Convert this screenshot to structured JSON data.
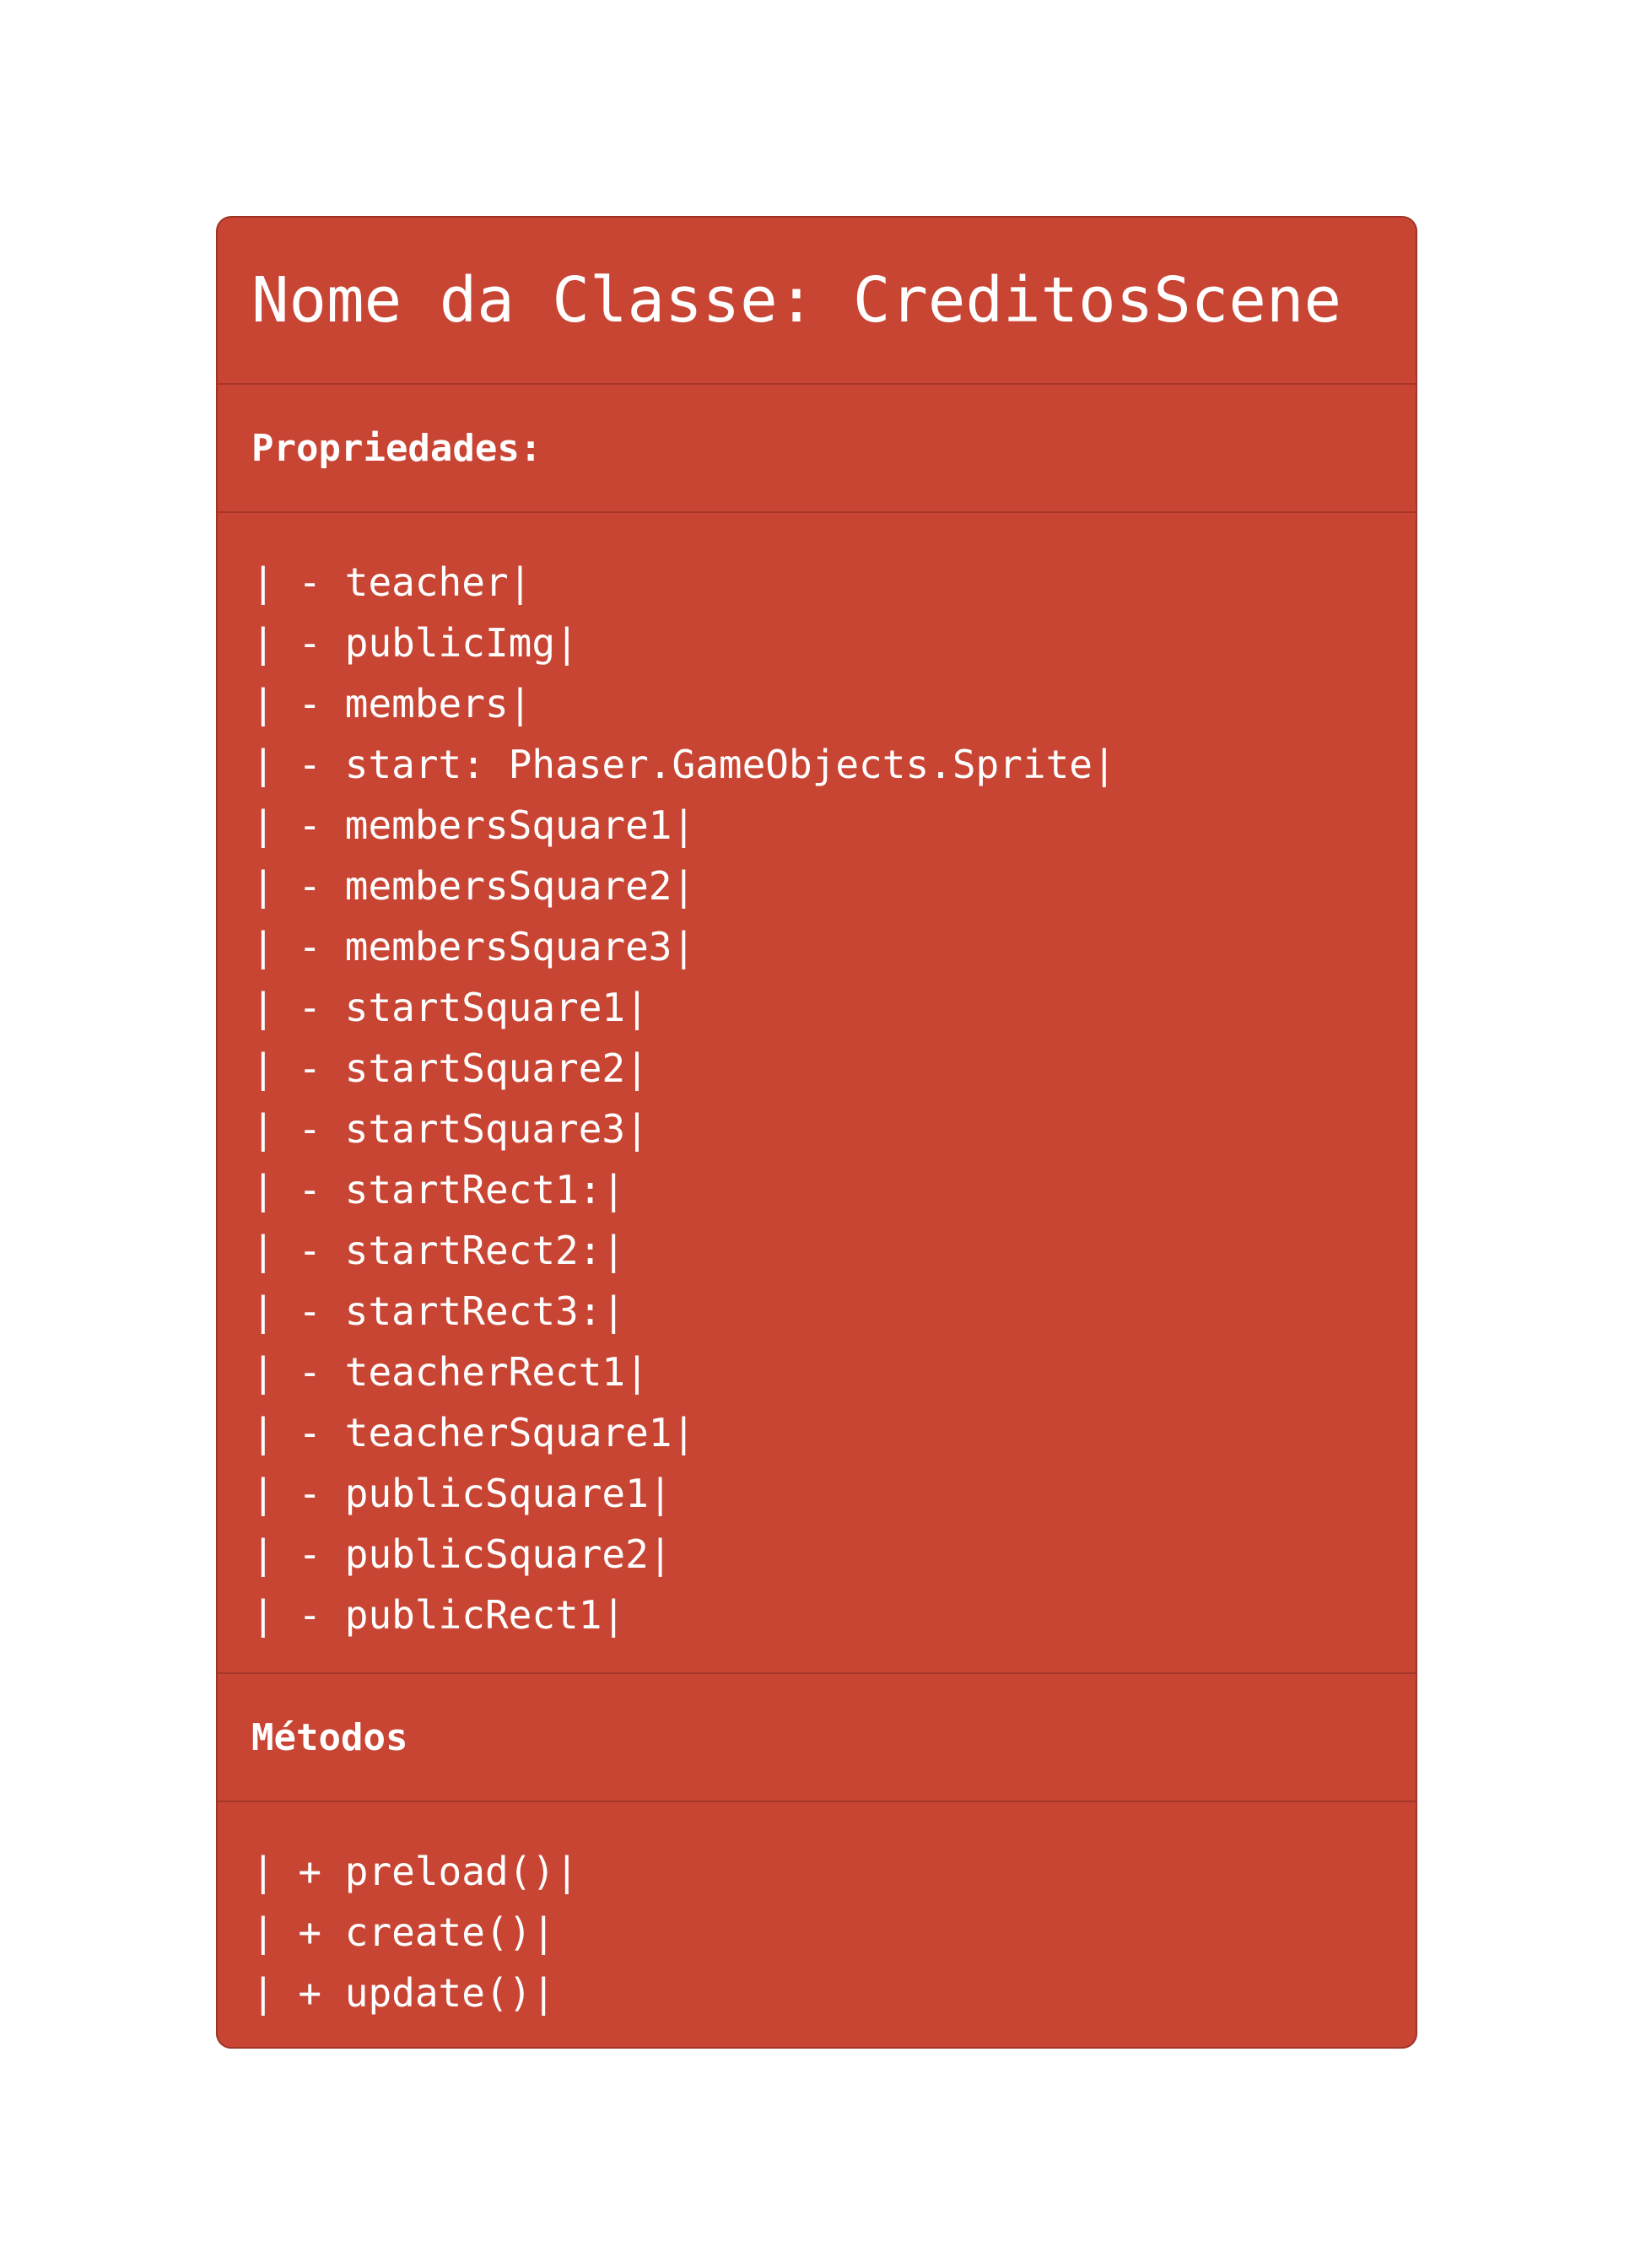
{
  "class_box": {
    "title": "Nome da Classe: CreditosScene",
    "properties_heading": "Propriedades:",
    "properties": [
      "| - teacher|",
      "| - publicImg|",
      "| - members|",
      "| - start: Phaser.GameObjects.Sprite|",
      "| - membersSquare1|",
      "| - membersSquare2|",
      "| - membersSquare3|",
      "| - startSquare1|",
      "| - startSquare2|",
      "| - startSquare3|",
      "| - startRect1:|",
      "| - startRect2:|",
      "| - startRect3:|",
      "| - teacherRect1|",
      "| - teacherSquare1|",
      "| - publicSquare1|",
      "| - publicSquare2|",
      "| - publicRect1|"
    ],
    "methods_heading": "Métodos",
    "methods": [
      "| + preload()|",
      "| + create()|",
      "| + update()|"
    ],
    "colors": {
      "background": "#c84534",
      "border": "#9f3326",
      "text": "#ffffff"
    }
  }
}
